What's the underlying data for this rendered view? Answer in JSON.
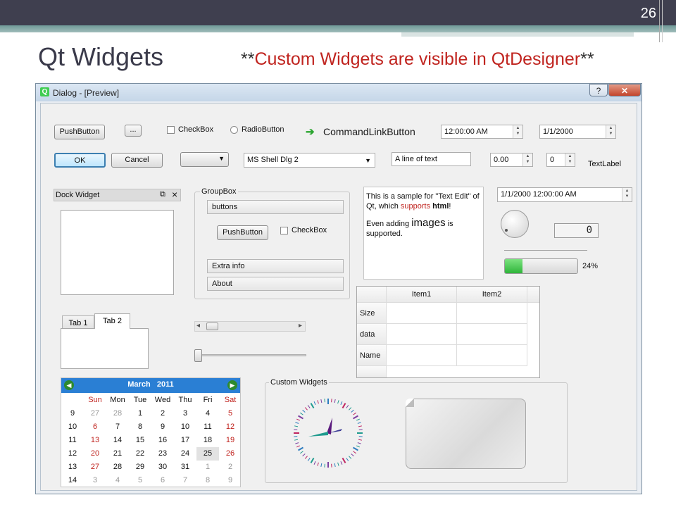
{
  "slide": {
    "number": "26",
    "title": "Qt Widgets",
    "subtitle_prefix": "**",
    "subtitle_text": "Custom Widgets are visible in QtDesigner",
    "subtitle_suffix": "**"
  },
  "dialog": {
    "title": "Dialog - [Preview]",
    "help_label": "?",
    "close_label": "✕",
    "row1": {
      "pushbutton": "PushButton",
      "tool_button": "...",
      "checkbox": "CheckBox",
      "radio": "RadioButton",
      "command_link": "CommandLinkButton",
      "time": "12:00:00 AM",
      "date": "1/1/2000"
    },
    "row2": {
      "ok": "OK",
      "cancel": "Cancel",
      "combo_empty": "",
      "font_combo": "MS Shell Dlg 2",
      "line_edit": "A line of text",
      "double_spin": "0.00",
      "spin": "0",
      "text_label": "TextLabel"
    },
    "dock": {
      "title": "Dock Widget",
      "float_icon": "⧉",
      "close_icon": "×"
    },
    "groupbox": {
      "title": "GroupBox",
      "buttons_label": "buttons",
      "pushbutton": "PushButton",
      "checkbox": "CheckBox",
      "extra_info": "Extra info",
      "about": "About"
    },
    "text_edit": {
      "line1_a": "This is a sample for \"Text Edit\" of",
      "line2_a": "Qt, which ",
      "line2_red": "supports",
      "line2_b": " ",
      "line2_bold": "html",
      "line2_c": "!",
      "line3_a": "Even adding ",
      "line3_big": "images",
      "line3_b": " is",
      "line4": "supported."
    },
    "datetime": "1/1/2000 12:00:00 AM",
    "lcd_value": "0",
    "progress": {
      "value": 0.24,
      "label": "24%"
    },
    "tabs": [
      {
        "label": "Tab 1"
      },
      {
        "label": "Tab 2"
      }
    ],
    "scrollbar": {
      "left_arrow": "◂",
      "right_arrow": "▸"
    },
    "table": {
      "columns": [
        "Item1",
        "Item2"
      ],
      "rows": [
        "Size",
        "data",
        "Name"
      ]
    },
    "calendar": {
      "month": "March",
      "year": "2011",
      "weekdays": [
        "Sun",
        "Mon",
        "Tue",
        "Wed",
        "Thu",
        "Fri",
        "Sat"
      ],
      "weeks": [
        {
          "week": "9",
          "days": [
            "27",
            "28",
            "1",
            "2",
            "3",
            "4",
            "5"
          ]
        },
        {
          "week": "10",
          "days": [
            "6",
            "7",
            "8",
            "9",
            "10",
            "11",
            "12"
          ]
        },
        {
          "week": "11",
          "days": [
            "13",
            "14",
            "15",
            "16",
            "17",
            "18",
            "19"
          ]
        },
        {
          "week": "12",
          "days": [
            "20",
            "21",
            "22",
            "23",
            "24",
            "25",
            "26"
          ]
        },
        {
          "week": "13",
          "days": [
            "27",
            "28",
            "29",
            "30",
            "31",
            "1",
            "2"
          ]
        },
        {
          "week": "14",
          "days": [
            "3",
            "4",
            "5",
            "6",
            "7",
            "8",
            "9"
          ]
        }
      ],
      "selected_day": "25",
      "accent": "#2a7fd4"
    },
    "custom_widgets": {
      "title": "Custom Widgets"
    },
    "colors": {
      "weekend": "#c0241f",
      "link": "#c0241f",
      "progress": "#3cc84a"
    }
  }
}
